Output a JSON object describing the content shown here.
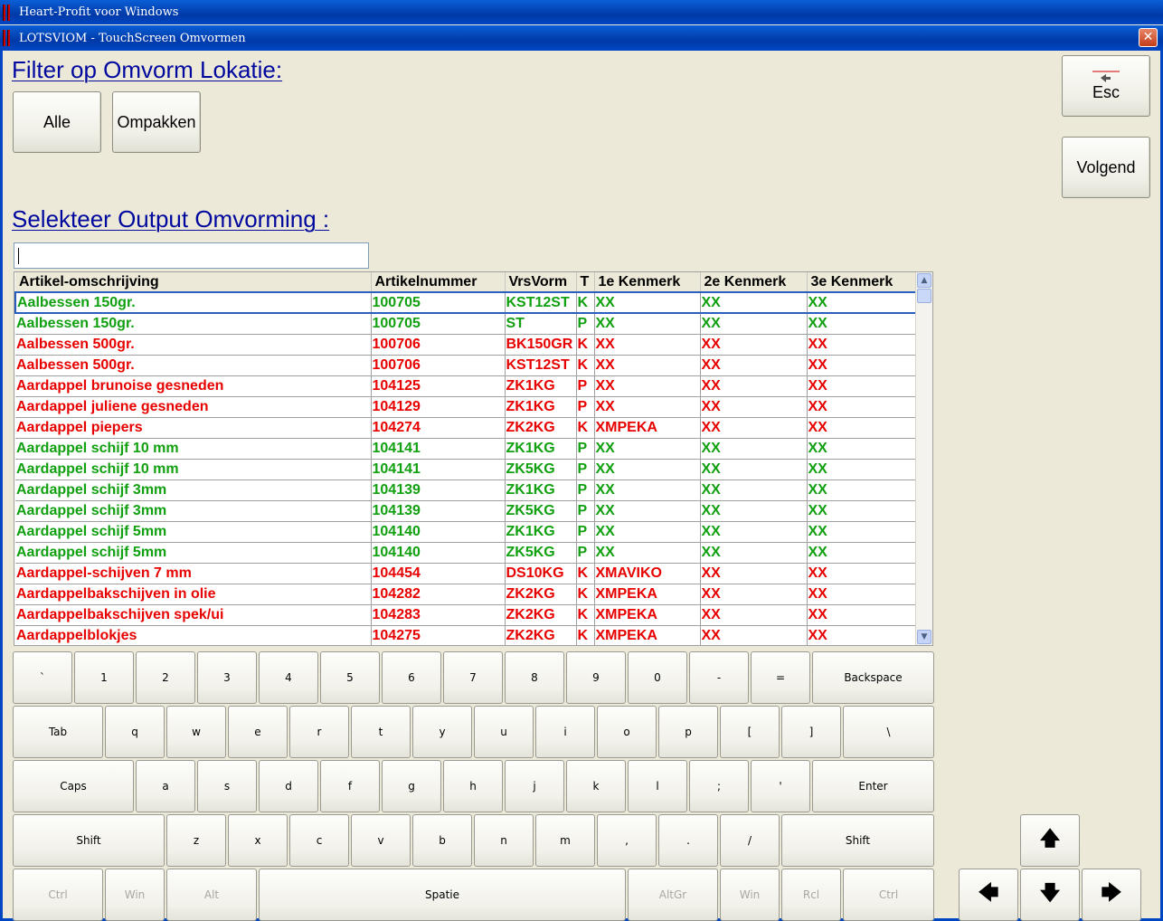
{
  "window": {
    "outer_title": "Heart-Profit voor Windows",
    "inner_title": "LOTSVIOM - TouchScreen Omvormen",
    "close_label": "✕"
  },
  "filter": {
    "heading": "Filter op Omvorm Lokatie:",
    "alle_label": "Alle",
    "ompakken_label": "Ompakken"
  },
  "actions": {
    "esc_label": "Esc",
    "volgend_label": "Volgend"
  },
  "select": {
    "heading": "Selekteer Output Omvorming :",
    "search_value": ""
  },
  "table": {
    "columns": [
      "Artikel-omschrijving",
      "Artikelnummer",
      "VrsVorm",
      "T",
      "1e Kenmerk",
      "2e Kenmerk",
      "3e Kenmerk"
    ],
    "rows": [
      {
        "desc": "Aalbessen 150gr.",
        "num": "100705",
        "vorm": "KST12ST",
        "t": "K",
        "k1": "XX",
        "k2": "XX",
        "k3": "XX",
        "color": "#10a010",
        "selected": true
      },
      {
        "desc": "Aalbessen 150gr.",
        "num": "100705",
        "vorm": "ST",
        "t": "P",
        "k1": "XX",
        "k2": "XX",
        "k3": "XX",
        "color": "#10a010"
      },
      {
        "desc": "Aalbessen 500gr.",
        "num": "100706",
        "vorm": "BK150GR",
        "t": "K",
        "k1": "XX",
        "k2": "XX",
        "k3": "XX",
        "color": "#e80000"
      },
      {
        "desc": "Aalbessen 500gr.",
        "num": "100706",
        "vorm": "KST12ST",
        "t": "K",
        "k1": "XX",
        "k2": "XX",
        "k3": "XX",
        "color": "#e80000"
      },
      {
        "desc": "Aardappel brunoise gesneden",
        "num": "104125",
        "vorm": "ZK1KG",
        "t": "P",
        "k1": "XX",
        "k2": "XX",
        "k3": "XX",
        "color": "#e80000"
      },
      {
        "desc": "Aardappel juliene gesneden",
        "num": "104129",
        "vorm": "ZK1KG",
        "t": "P",
        "k1": "XX",
        "k2": "XX",
        "k3": "XX",
        "color": "#e80000"
      },
      {
        "desc": "Aardappel piepers",
        "num": "104274",
        "vorm": "ZK2KG",
        "t": "K",
        "k1": "XMPEKA",
        "k2": "XX",
        "k3": "XX",
        "color": "#e80000"
      },
      {
        "desc": "Aardappel schijf 10 mm",
        "num": "104141",
        "vorm": "ZK1KG",
        "t": "P",
        "k1": "XX",
        "k2": "XX",
        "k3": "XX",
        "color": "#10a010"
      },
      {
        "desc": "Aardappel schijf 10 mm",
        "num": "104141",
        "vorm": "ZK5KG",
        "t": "P",
        "k1": "XX",
        "k2": "XX",
        "k3": "XX",
        "color": "#10a010"
      },
      {
        "desc": "Aardappel schijf 3mm",
        "num": "104139",
        "vorm": "ZK1KG",
        "t": "P",
        "k1": "XX",
        "k2": "XX",
        "k3": "XX",
        "color": "#10a010"
      },
      {
        "desc": "Aardappel schijf 3mm",
        "num": "104139",
        "vorm": "ZK5KG",
        "t": "P",
        "k1": "XX",
        "k2": "XX",
        "k3": "XX",
        "color": "#10a010"
      },
      {
        "desc": "Aardappel schijf 5mm",
        "num": "104140",
        "vorm": "ZK1KG",
        "t": "P",
        "k1": "XX",
        "k2": "XX",
        "k3": "XX",
        "color": "#10a010"
      },
      {
        "desc": "Aardappel schijf 5mm",
        "num": "104140",
        "vorm": "ZK5KG",
        "t": "P",
        "k1": "XX",
        "k2": "XX",
        "k3": "XX",
        "color": "#10a010"
      },
      {
        "desc": "Aardappel-schijven 7 mm",
        "num": "104454",
        "vorm": "DS10KG",
        "t": "K",
        "k1": "XMAVIKO",
        "k2": "XX",
        "k3": "XX",
        "color": "#e80000"
      },
      {
        "desc": "Aardappelbakschijven in olie",
        "num": "104282",
        "vorm": "ZK2KG",
        "t": "K",
        "k1": "XMPEKA",
        "k2": "XX",
        "k3": "XX",
        "color": "#e80000"
      },
      {
        "desc": "Aardappelbakschijven spek/ui",
        "num": "104283",
        "vorm": "ZK2KG",
        "t": "K",
        "k1": "XMPEKA",
        "k2": "XX",
        "k3": "XX",
        "color": "#e80000"
      },
      {
        "desc": "Aardappelblokjes",
        "num": "104275",
        "vorm": "ZK2KG",
        "t": "K",
        "k1": "XMPEKA",
        "k2": "XX",
        "k3": "XX",
        "color": "#e80000"
      }
    ]
  },
  "keyboard": {
    "row1": [
      "`",
      "1",
      "2",
      "3",
      "4",
      "5",
      "6",
      "7",
      "8",
      "9",
      "0",
      "-",
      "=",
      "Backspace"
    ],
    "row2": [
      "Tab",
      "q",
      "w",
      "e",
      "r",
      "t",
      "y",
      "u",
      "i",
      "o",
      "p",
      "[",
      "]",
      "\\"
    ],
    "row3": [
      "Caps",
      "a",
      "s",
      "d",
      "f",
      "g",
      "h",
      "j",
      "k",
      "l",
      ";",
      "'",
      "Enter"
    ],
    "row4": [
      "Shift",
      "z",
      "x",
      "c",
      "v",
      "b",
      "n",
      "m",
      ",",
      ".",
      "/",
      "Shift"
    ],
    "row5": [
      "Ctrl",
      "Win",
      "Alt",
      "Spatie",
      "AltGr",
      "Win",
      "Rcl",
      "Ctrl"
    ],
    "row5_disabled": [
      true,
      true,
      true,
      false,
      true,
      true,
      true,
      true
    ]
  },
  "arrows": {
    "up": "🡅",
    "left": "🡄",
    "down": "🡇",
    "right": "🡆"
  }
}
